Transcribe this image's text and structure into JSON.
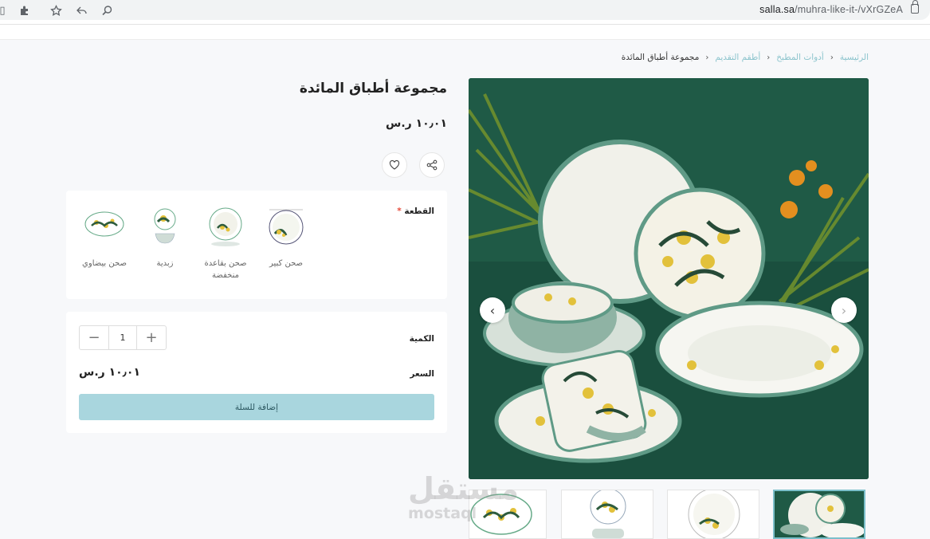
{
  "browser": {
    "url_host": "salla.sa",
    "url_path": "/muhra-like-it-/vXrGZeA"
  },
  "breadcrumb": {
    "items": [
      "الرئيسية",
      "أدوات المطبخ",
      "أطقم التقديم",
      "مجموعة أطباق المائدة"
    ]
  },
  "product": {
    "title": "مجموعة أطباق المائدة",
    "price": "١٠٫٠١ ر.س"
  },
  "options": {
    "label": "القطعة",
    "required_mark": "*",
    "items": [
      "صحن كبير",
      "صحن بقاعدة منخفضة",
      "زبدية",
      "صحن بيضاوي"
    ]
  },
  "purchase": {
    "quantity_label": "الكمية",
    "quantity_value": "1",
    "price_label": "السعر",
    "price_value": "١٠٫٠١ ر.س",
    "add_to_cart_label": "إضافة للسلة"
  },
  "gallery": {
    "thumbnail_count": 4
  },
  "watermark": {
    "arabic": "مستقل",
    "latin": "mostaql"
  },
  "colors": {
    "accent": "#8cc4cd",
    "button": "#a9d6de",
    "image_bg": "#1f5a46"
  }
}
